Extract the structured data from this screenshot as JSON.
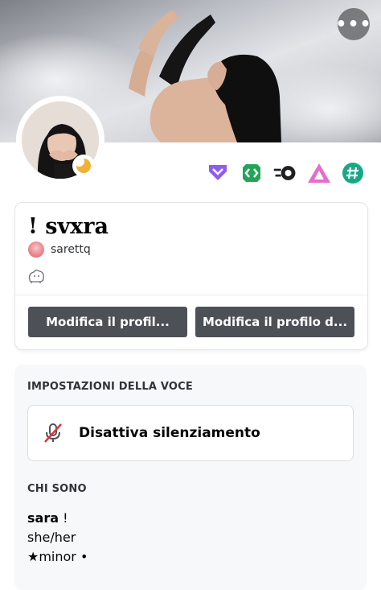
{
  "header": {
    "more_label": "•••"
  },
  "profile": {
    "display_name": "! svxra",
    "username": "sarettq",
    "status": "idle"
  },
  "badges": [
    {
      "icon": "nitro-subscriber-icon",
      "color": "#8f5cf0"
    },
    {
      "icon": "active-developer-icon",
      "color": "#23a559"
    },
    {
      "icon": "server-boost-icon",
      "color": "#1e1f22"
    },
    {
      "icon": "hypesquad-icon",
      "color": "#e56dcd"
    },
    {
      "icon": "hashtag-quest-icon",
      "color": "#18a884"
    }
  ],
  "actions": {
    "edit_profile": "Modifica il profil...",
    "edit_server_profile": "Modifica il profilo d..."
  },
  "voice": {
    "section_title": "IMPOSTAZIONI DELLA VOCE",
    "unmute_label": "Disattiva silenziamento"
  },
  "about": {
    "section_title": "CHI SONO",
    "line1_bold": "sara",
    "line1_rest": " !",
    "line2": "she/her",
    "line3": "★minor •"
  },
  "colors": {
    "button_bg": "#4e5058",
    "idle_status": "#f0b232",
    "mute_red": "#da373c"
  }
}
